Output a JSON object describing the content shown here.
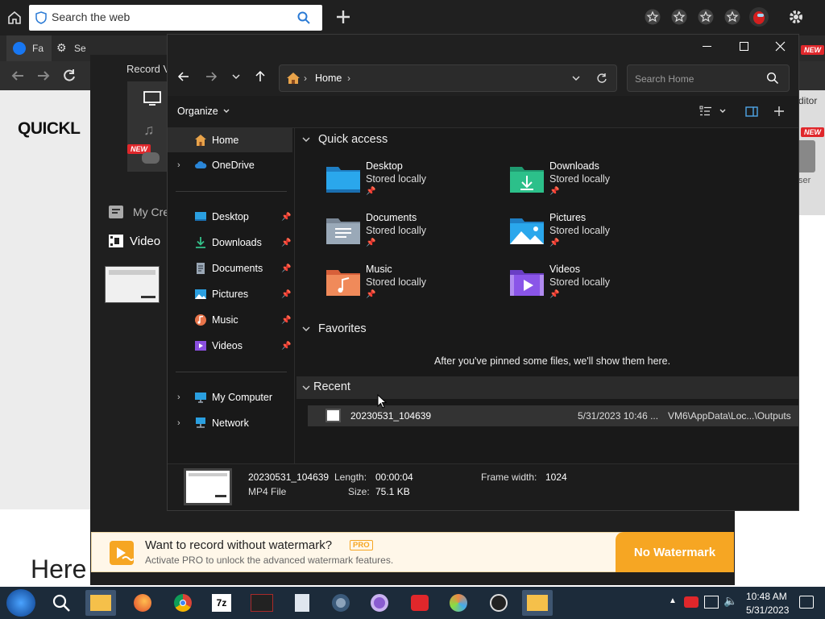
{
  "browser": {
    "search_placeholder": "Search the web",
    "tabs": [
      {
        "label": "Fa"
      },
      {
        "label": "Se"
      }
    ]
  },
  "app": {
    "record_label": "Record V",
    "brand": "QUICKL",
    "new_badge": "NEW",
    "my_creations": "My Cre",
    "video_label": "Video",
    "right_editor": "ditor",
    "right_ser": "ser",
    "big_text": "Here"
  },
  "explorer": {
    "breadcrumb": "Home",
    "search_placeholder": "Search Home",
    "organize": "Organize",
    "nav": {
      "home": "Home",
      "onedrive": "OneDrive",
      "pinned": [
        "Desktop",
        "Downloads",
        "Documents",
        "Pictures",
        "Music",
        "Videos"
      ],
      "my_computer": "My Computer",
      "network": "Network"
    },
    "quick_access_title": "Quick access",
    "quick_access": [
      {
        "name": "Desktop",
        "status": "Stored locally",
        "icon": "desktop-folder"
      },
      {
        "name": "Downloads",
        "status": "Stored locally",
        "icon": "downloads-folder"
      },
      {
        "name": "Documents",
        "status": "Stored locally",
        "icon": "documents-folder"
      },
      {
        "name": "Pictures",
        "status": "Stored locally",
        "icon": "pictures-folder"
      },
      {
        "name": "Music",
        "status": "Stored locally",
        "icon": "music-folder"
      },
      {
        "name": "Videos",
        "status": "Stored locally",
        "icon": "videos-folder"
      }
    ],
    "favorites_title": "Favorites",
    "favorites_empty": "After you've pinned some files, we'll show them here.",
    "recent_title": "Recent",
    "recent": [
      {
        "name": "20230531_104639",
        "date": "5/31/2023 10:46 ...",
        "location": "VM6\\AppData\\Loc...\\Outputs"
      }
    ],
    "details": {
      "name": "20230531_104639",
      "type": "MP4 File",
      "length_label": "Length:",
      "length_value": "00:00:04",
      "size_label": "Size:",
      "size_value": "75.1 KB",
      "frame_width_label": "Frame width:",
      "frame_width_value": "1024"
    }
  },
  "banner": {
    "title": "Want to record without watermark?",
    "pro": "PRO",
    "subtitle": "Activate PRO to unlock the advanced watermark features.",
    "button": "No Watermark"
  },
  "taskbar": {
    "time": "10:48 AM",
    "date": "5/31/2023"
  },
  "colors": {
    "accent": "#f6a623",
    "new_badge": "#e0272b",
    "folder_blue": "#2a9fe0"
  }
}
